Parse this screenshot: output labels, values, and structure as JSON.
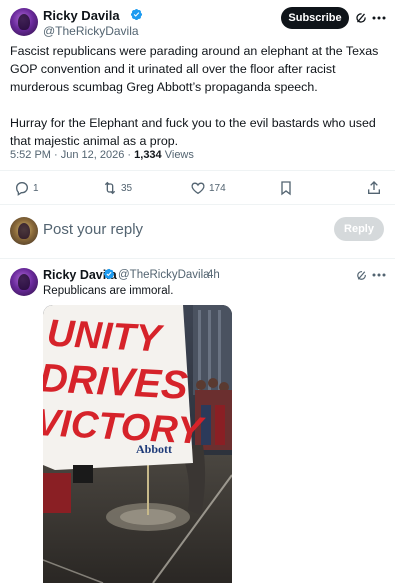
{
  "main_tweet": {
    "author_name": "Ricky Davila",
    "author_handle": "@TheRickyDavila",
    "subscribe_label": "Subscribe",
    "paragraphs": [
      "Fascist republicans were parading around an elephant at the Texas GOP convention and it urinated all over the floor after racist murderous scumbag Greg Abbott’s propaganda speech.",
      "Hurray for the Elephant and fuck you to the evil bastards who used that majestic animal as a prop."
    ],
    "timestamp": "5:52 PM · Jun 12, 2026 ·",
    "views_count": "1,334",
    "views_label": "Views",
    "actions": {
      "replies": "1",
      "retweets": "35",
      "likes": "174"
    }
  },
  "reply_box": {
    "placeholder": "Post your reply",
    "button_label": "Reply"
  },
  "reply_tweet": {
    "author_name": "Ricky Davila",
    "author_handle": "@TheRickyDavila",
    "time_ago": "· 4h",
    "text": "Republicans are immoral.",
    "media": {
      "banner_lines": [
        "UNITY",
        "DRIVES",
        "VICTORY"
      ],
      "banner_name": "Abbott"
    }
  },
  "icons": {
    "verified": "verified-badge-icon",
    "grok": "grok-icon",
    "more": "more-icon",
    "reply": "reply-icon",
    "retweet": "retweet-icon",
    "like": "like-icon",
    "bookmark": "bookmark-icon",
    "share": "share-icon"
  },
  "colors": {
    "verified_blue": "#1d9bf0",
    "text_primary": "#0f1419",
    "text_secondary": "#536471",
    "divider": "#eff3f4",
    "banner_red": "#d6232a"
  }
}
